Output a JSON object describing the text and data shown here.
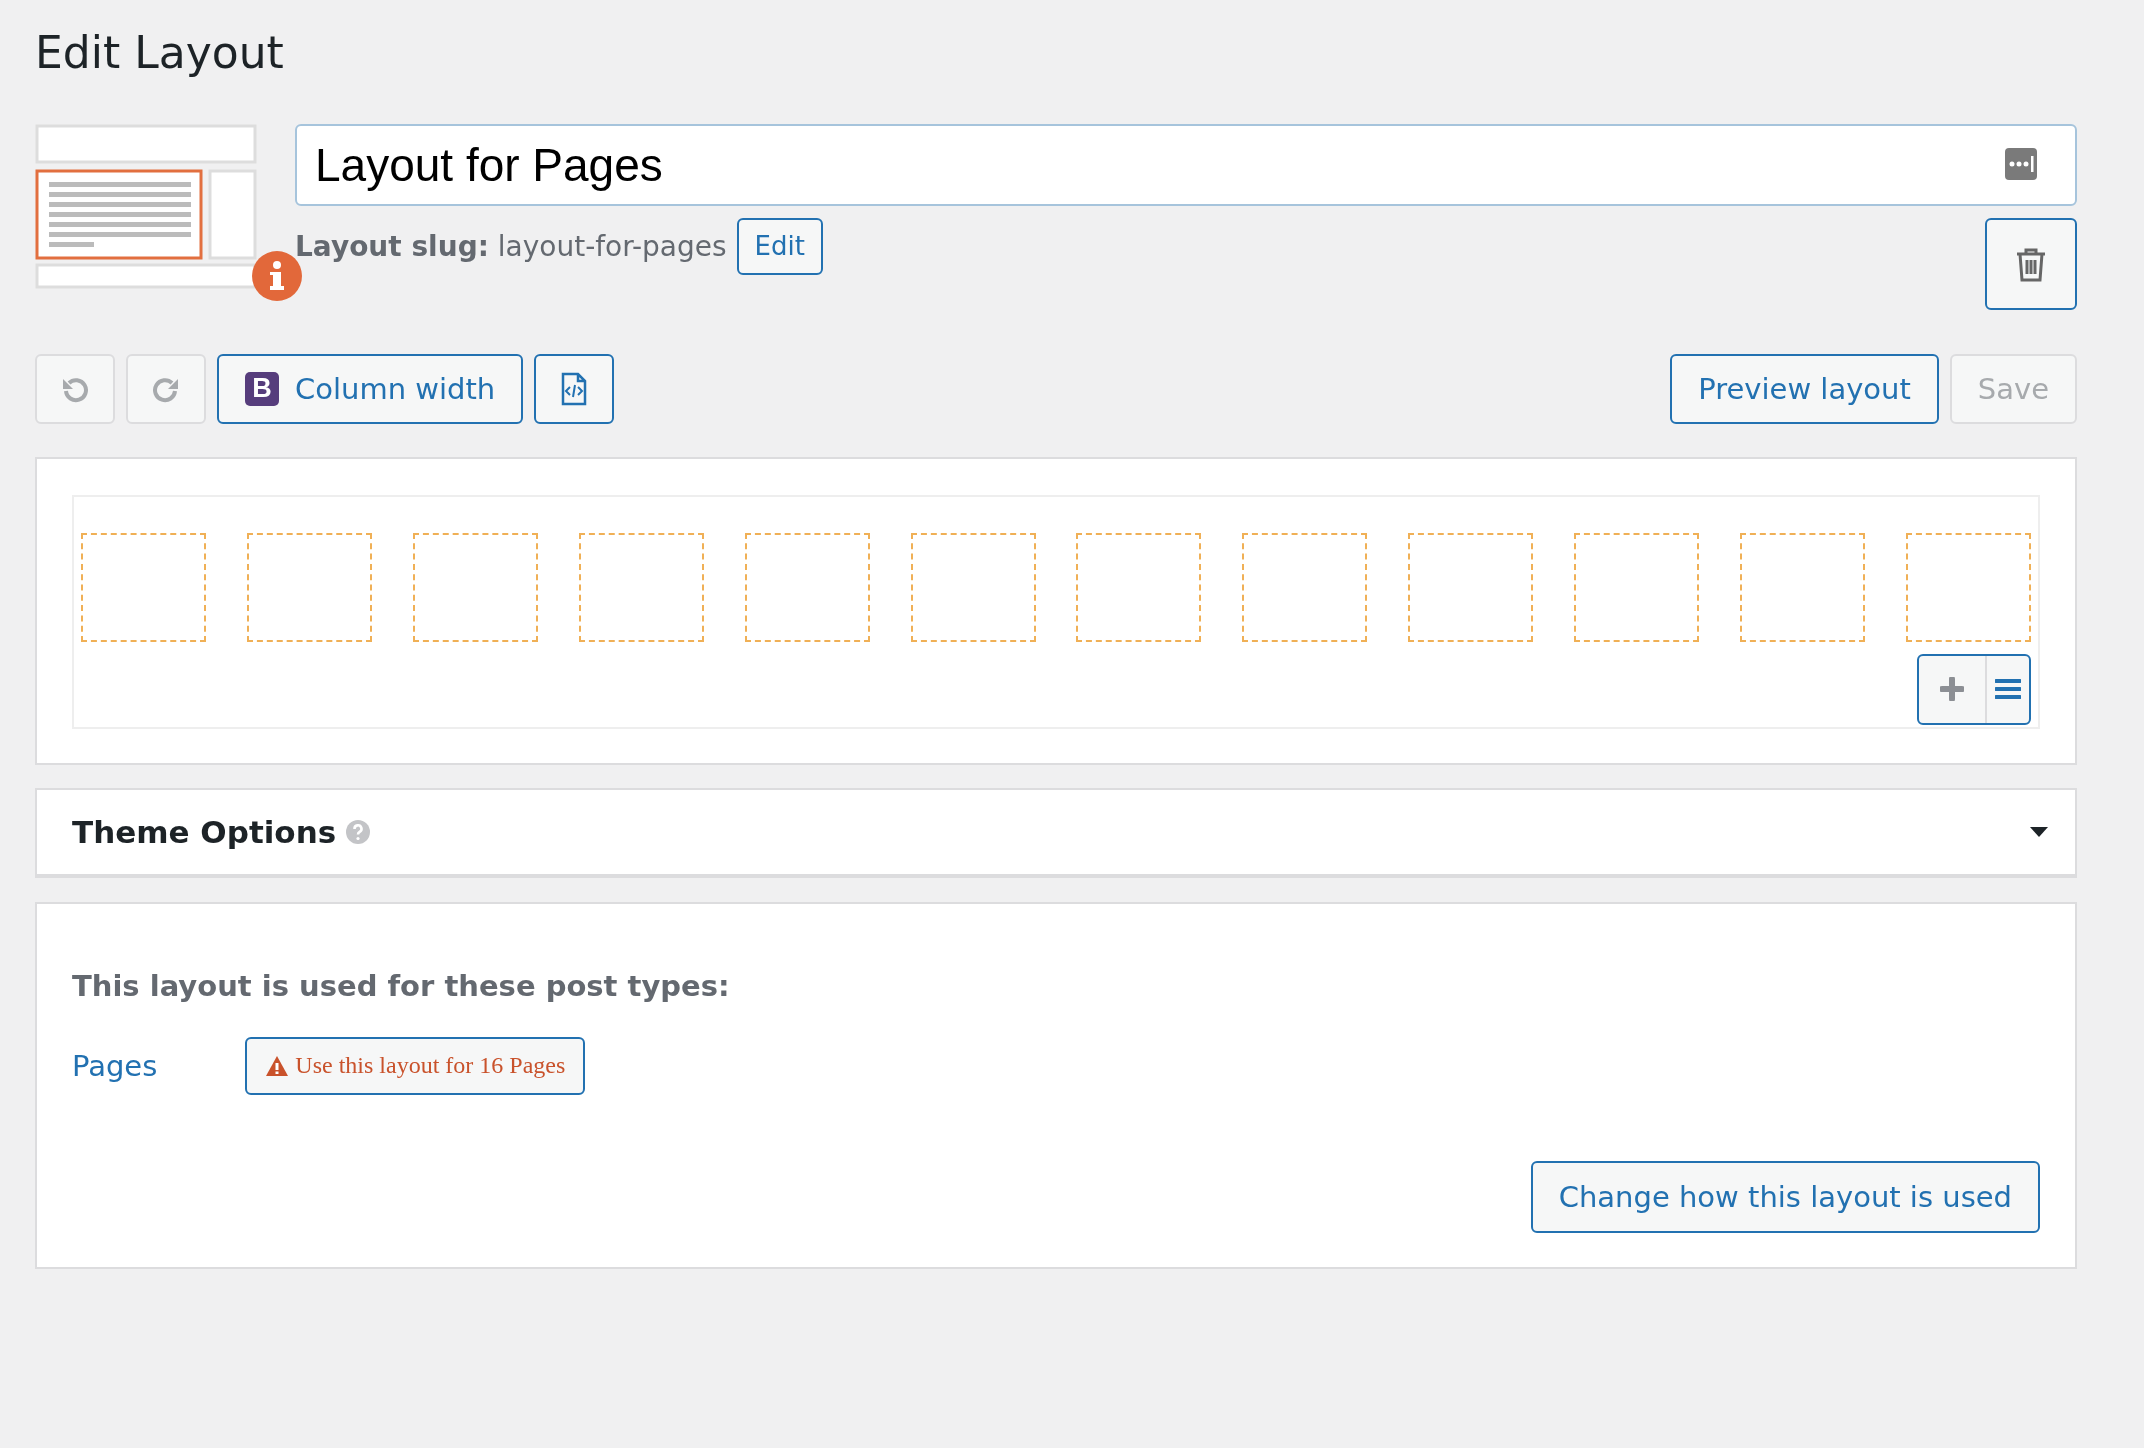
{
  "page_title": "Edit Layout",
  "layout": {
    "title": "Layout for Pages",
    "slug_label": "Layout slug:",
    "slug": "layout-for-pages",
    "edit_button": "Edit"
  },
  "toolbar": {
    "buttons": [
      {
        "kind": "undo",
        "disabled": true
      },
      {
        "kind": "redo",
        "disabled": true
      },
      {
        "kind": "column-width",
        "label": "Column width",
        "badge": "B",
        "disabled": false
      },
      {
        "kind": "code",
        "disabled": false
      }
    ],
    "preview_button": "Preview layout",
    "save_button": {
      "label": "Save",
      "disabled": true
    }
  },
  "grid": {
    "cells": [
      {
        "kind": "empty"
      },
      {
        "kind": "empty"
      },
      {
        "kind": "empty"
      },
      {
        "kind": "empty"
      },
      {
        "kind": "empty"
      },
      {
        "kind": "empty"
      },
      {
        "kind": "empty"
      },
      {
        "kind": "empty"
      },
      {
        "kind": "empty"
      },
      {
        "kind": "empty"
      },
      {
        "kind": "empty"
      },
      {
        "kind": "empty"
      }
    ]
  },
  "theme_options": {
    "title": "Theme Options",
    "expanded": false
  },
  "usage": {
    "heading": "This layout is used for these post types:",
    "post_types": [
      {
        "name": "Pages",
        "action": "Use this layout for 16 Pages"
      }
    ],
    "change_button": "Change how this layout is used"
  }
}
